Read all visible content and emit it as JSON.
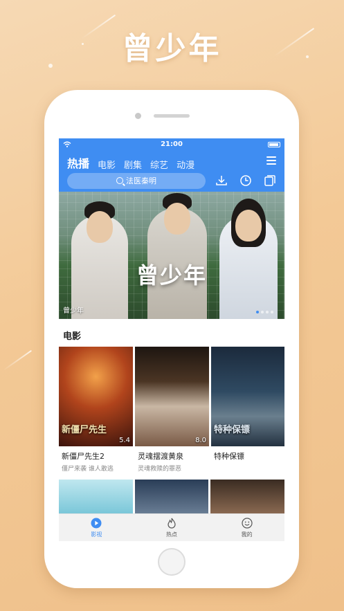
{
  "promo": {
    "title": "曾少年"
  },
  "status_bar": {
    "time": "21:00"
  },
  "header": {
    "tabs": [
      {
        "label": "热播",
        "active": true
      },
      {
        "label": "电影",
        "active": false
      },
      {
        "label": "剧集",
        "active": false
      },
      {
        "label": "综艺",
        "active": false
      },
      {
        "label": "动漫",
        "active": false
      }
    ],
    "search": {
      "placeholder": "法医秦明"
    },
    "icons": [
      "download-icon",
      "history-icon",
      "screen-icon",
      "menu-icon"
    ],
    "accent_color": "#3f8df2"
  },
  "banner": {
    "title": "曾少年",
    "caption": "曾少年",
    "dots": 4,
    "active_dot": 1
  },
  "section": {
    "title": "电影"
  },
  "movies": [
    {
      "name": "新僵尸先生2",
      "sub": "僵尸来袭 谁人敢逃",
      "poster_text": "新僵尸先生",
      "rating": "5.4"
    },
    {
      "name": "灵魂摆渡黄泉",
      "sub": "灵魂救赎的罪恶",
      "poster_text": "",
      "rating": "8.0"
    },
    {
      "name": "特种保镖",
      "sub": "",
      "poster_text": "特种保镖",
      "rating": ""
    }
  ],
  "bottom_nav": [
    {
      "label": "影视",
      "icon": "play-icon",
      "active": true
    },
    {
      "label": "热点",
      "icon": "flame-icon",
      "active": false
    },
    {
      "label": "我的",
      "icon": "smile-icon",
      "active": false
    }
  ]
}
